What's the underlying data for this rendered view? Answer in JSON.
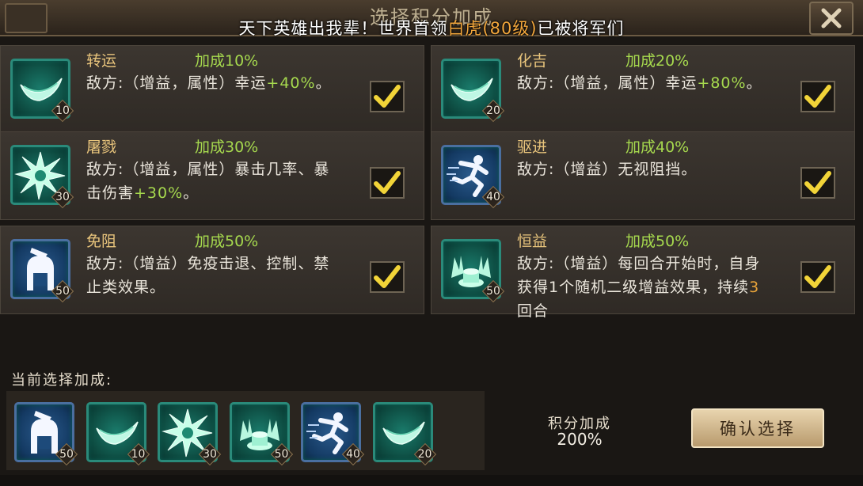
{
  "header": {
    "title": "选择积分加成",
    "marquee_prefix": "天下英雄出我辈！世界首领",
    "marquee_highlight": "白虎(80级)",
    "marquee_suffix": "已被将军们",
    "close_icon": "close-icon"
  },
  "cards": [
    {
      "name": "转运",
      "bonus": "加成10%",
      "desc_a": "敌方:（增益，属性）幸运",
      "desc_g": "+40%",
      "desc_b": "。",
      "level": "10",
      "icon": "horn-icon",
      "checked": true
    },
    {
      "name": "化吉",
      "bonus": "加成20%",
      "desc_a": "敌方:（增益，属性）幸运",
      "desc_g": "+80%",
      "desc_b": "。",
      "level": "20",
      "icon": "horn-icon",
      "checked": true
    },
    {
      "name": "屠戮",
      "bonus": "加成30%",
      "desc_a": "敌方:（增益，属性）暴击几率、暴击伤害",
      "desc_g": "+30%",
      "desc_b": "。",
      "level": "30",
      "icon": "burst-icon",
      "checked": true
    },
    {
      "name": "驱进",
      "bonus": "加成40%",
      "desc_a": "敌方:（增益）无视阻挡。",
      "desc_g": "",
      "desc_b": "",
      "level": "40",
      "icon": "running-figure-icon",
      "checked": true
    },
    {
      "name": "免阻",
      "bonus": "加成50%",
      "desc_a": "敌方:（增益）免疫击退、控制、禁止类效果。",
      "desc_g": "",
      "desc_b": "",
      "level": "50",
      "icon": "helmet-head-icon",
      "checked": true
    },
    {
      "name": "恒益",
      "bonus": "加成50%",
      "desc_a": "敌方:（增益）每回合开始时，自身获得1个随机二级增益效果，持续",
      "desc_o": "3",
      "desc_b": "回合",
      "level": "50",
      "icon": "altar-icon",
      "checked": true
    }
  ],
  "current": {
    "label": "当前选择加成:",
    "items": [
      {
        "icon": "helmet-head-icon",
        "level": "50"
      },
      {
        "icon": "horn-icon",
        "level": "10"
      },
      {
        "icon": "burst-icon",
        "level": "30"
      },
      {
        "icon": "altar-icon",
        "level": "50"
      },
      {
        "icon": "running-figure-icon",
        "level": "40"
      },
      {
        "icon": "horn-icon",
        "level": "20"
      }
    ]
  },
  "score": {
    "label": "积分加成",
    "value": "200%"
  },
  "confirm_label": "确认选择",
  "colors": {
    "accent_green": "#a6d94e",
    "name_gold": "#e9c57c",
    "highlight_orange": "#f3a73c",
    "check_yellow": "#f2d438"
  }
}
